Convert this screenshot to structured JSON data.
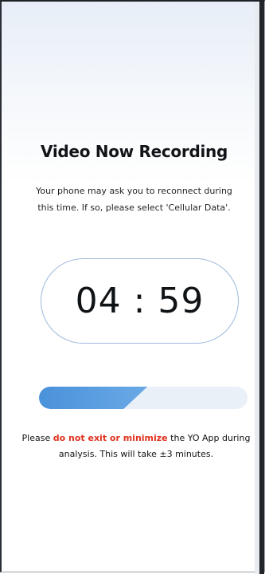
{
  "screen": {
    "title": "Video Now Recording",
    "subtitle": "Your phone may ask you to reconnect during this time. If so, please select 'Cellular Data'.",
    "timer": "04 : 59",
    "progress_fraction": 0.52,
    "warning_before": "Please ",
    "warning_emphasis": "do not exit or minimize",
    "warning_after": " the YO App during analysis. This will take ±3 minutes."
  },
  "colors": {
    "accent_blue": "#4a92da",
    "warning_red": "#e0321e",
    "pill_border": "#9db8dd"
  }
}
